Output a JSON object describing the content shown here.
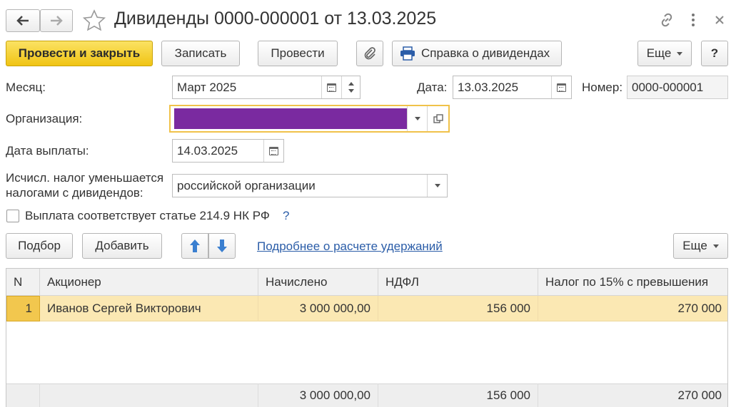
{
  "header": {
    "title": "Дивиденды 0000-000001 от 13.03.2025"
  },
  "toolbar": {
    "post_close": "Провести и закрыть",
    "save": "Записать",
    "post": "Провести",
    "report": "Справка о дивидендах",
    "more": "Еще",
    "help": "?"
  },
  "form": {
    "month_label": "Месяц:",
    "month_value": "Март 2025",
    "date_label": "Дата:",
    "date_value": "13.03.2025",
    "number_label": "Номер:",
    "number_value": "0000-000001",
    "org_label": "Организация:",
    "org_fill_color": "#7a2aa0",
    "pay_date_label": "Дата выплаты:",
    "pay_date_value": "14.03.2025",
    "tax_label_line1": "Исчисл. налог уменьшается",
    "tax_label_line2": "налогами с дивидендов:",
    "tax_value": "российской организации",
    "checkbox_label": "Выплата соответствует статье 214.9 НК РФ",
    "checkbox_checked": false,
    "help_mark": "?"
  },
  "table_toolbar": {
    "pick": "Подбор",
    "add": "Добавить",
    "details_link": "Подробнее о расчете удержаний",
    "more": "Еще"
  },
  "table": {
    "columns": [
      "N",
      "Акционер",
      "Начислено",
      "НДФЛ",
      "Налог по 15% с превышения"
    ],
    "rows": [
      {
        "n": "1",
        "holder": "Иванов Сергей Викторович",
        "accrued": "3 000 000,00",
        "ndfl": "156 000",
        "tax15": "270 000"
      }
    ],
    "totals": {
      "accrued": "3 000 000,00",
      "ndfl": "156 000",
      "tax15": "270 000"
    }
  },
  "colors": {
    "primary_button": "#f5d02a",
    "selected_row": "#fbe8b3",
    "link": "#2b5da8",
    "focus_border": "#f0c24a"
  }
}
